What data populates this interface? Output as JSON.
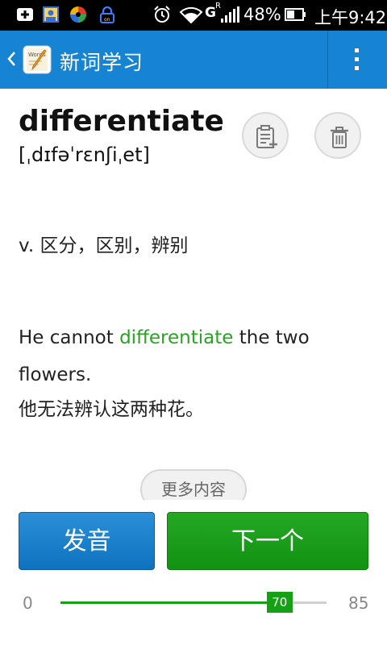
{
  "status_bar": {
    "battery": "48%",
    "time": "上午9:42",
    "network_type": "G",
    "roaming": "R",
    "icons": [
      "add-notification-icon",
      "contacts-app-icon",
      "swirl-app-icon",
      "lock-app-icon",
      "alarm-icon",
      "wifi-icon",
      "signal-icon",
      "battery-icon"
    ]
  },
  "action_bar": {
    "title": "新词学习",
    "back_icon": "chevron-left-icon",
    "logo_icon": "word-notebook-icon",
    "menu_icon": "overflow-menu-icon",
    "color": "#1784d3"
  },
  "word": {
    "text": "differentiate",
    "phonetic": "[ˌdɪfəˈrɛnʃiˌet]"
  },
  "actions": {
    "add_to_list_icon": "add-to-list-icon",
    "delete_icon": "trash-icon"
  },
  "definition": "v. 区分，区别，辨别",
  "example": {
    "before": "He cannot ",
    "highlight": "differentiate",
    "after": " the two flowers.",
    "translation": "他无法辨认这两种花。",
    "highlight_color": "#2aa323"
  },
  "more_button": "更多内容",
  "buttons": {
    "pronounce": "发音",
    "next": "下一个"
  },
  "progress": {
    "min": "0",
    "max": "85",
    "current": "70",
    "value": 70,
    "total": 85,
    "color": "#16a016"
  }
}
